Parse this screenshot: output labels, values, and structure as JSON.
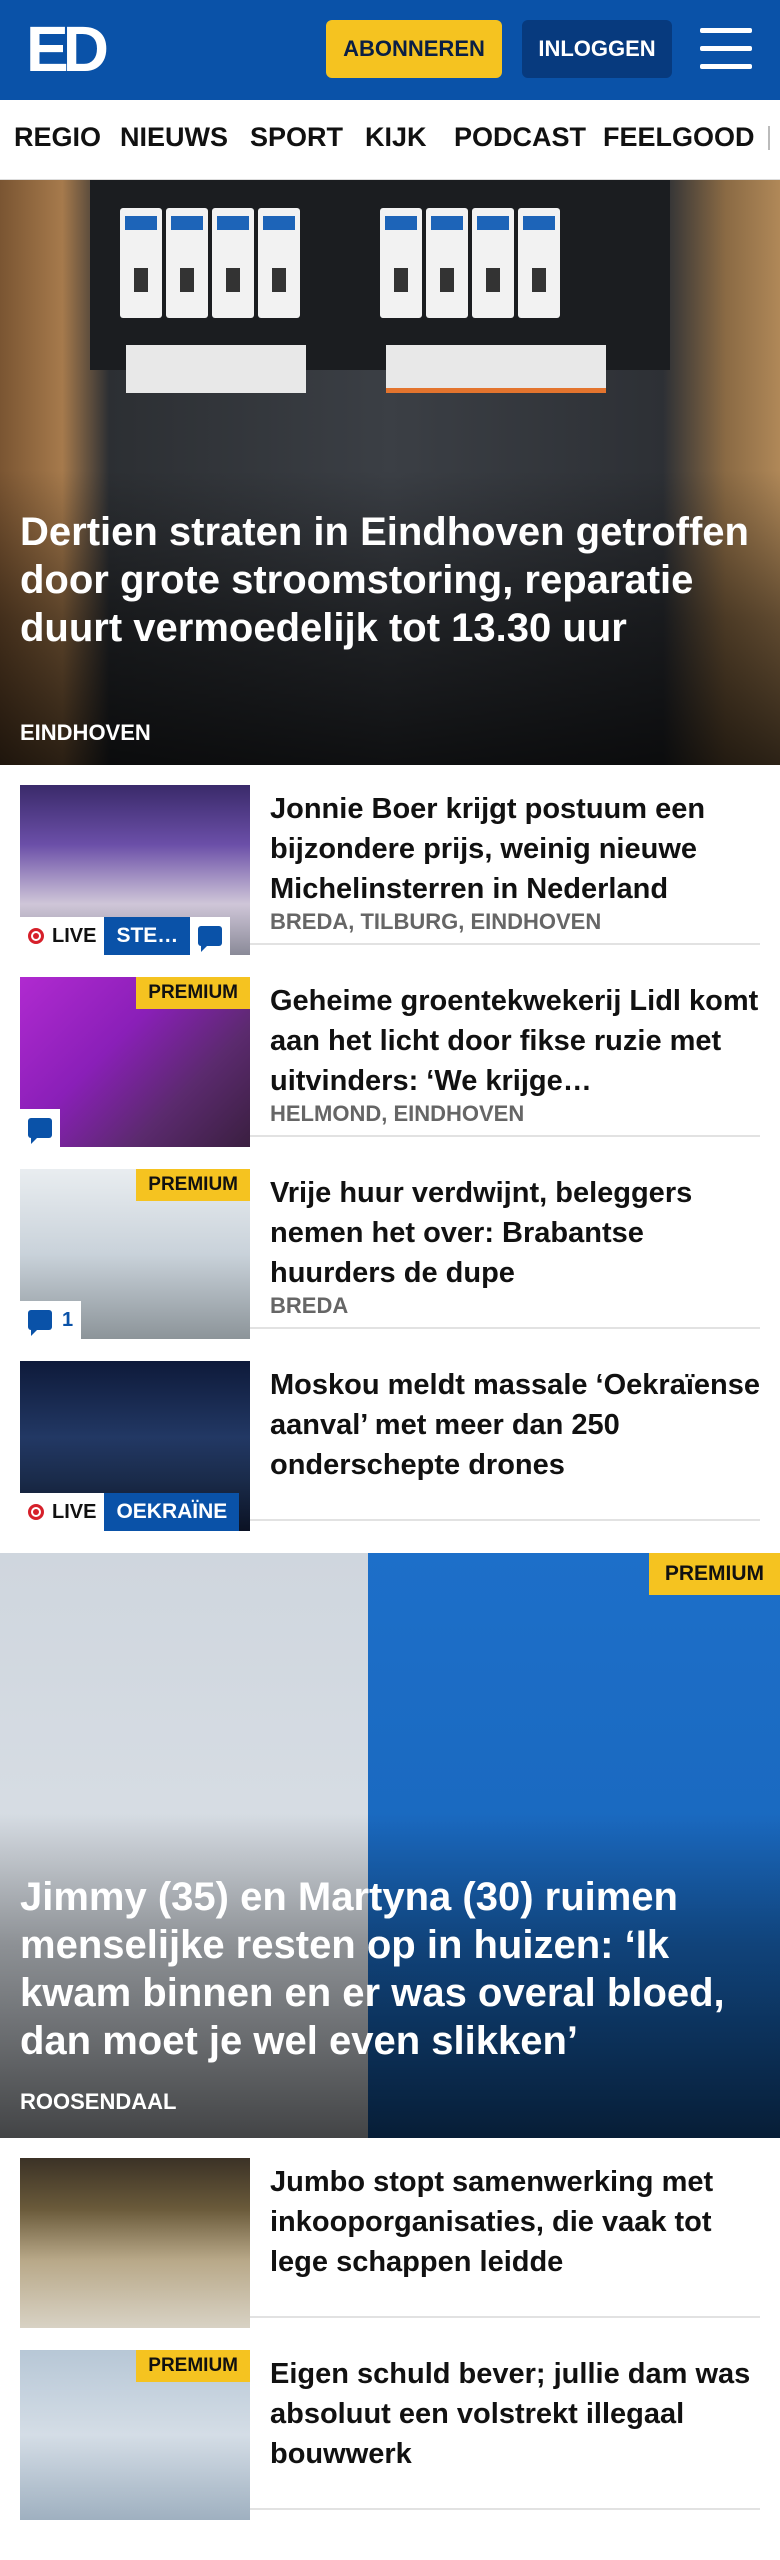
{
  "header": {
    "logo": "ED",
    "subscribe_label": "ABONNEREN",
    "login_label": "INLOGGEN",
    "menu_icon": "hamburger-icon"
  },
  "nav": {
    "items": [
      "REGIO",
      "NIEUWS",
      "SPORT",
      "KIJK",
      "PODCAST",
      "FEELGOOD"
    ]
  },
  "hero": {
    "title": "Dertien straten in Eindhoven getroffen door grote stroomstoring, reparatie duurt vermoedelijk tot 13.30 uur",
    "region": "EINDHOVEN"
  },
  "articles": [
    {
      "title": "Jonnie Boer krijgt postuum een bijzondere prijs, weinig nieuwe Michelinsterren in Nederland",
      "region": "BREDA, TILBURG, EINDHOVEN",
      "live_label": "LIVE",
      "live_topic": "STE…",
      "comment_icon": "comment-icon"
    },
    {
      "title": "Geheime groentekwekerij Lidl komt aan het licht door fikse ruzie met uitvinders: ‘We krijge…",
      "region": "HELMOND, EINDHOVEN",
      "premium_label": "PREMIUM",
      "comment_icon": "comment-icon"
    },
    {
      "title": "Vrije huur verdwijnt, beleggers nemen het over: Brabantse huurders de dupe",
      "region": "BREDA",
      "premium_label": "PREMIUM",
      "comment_count": "1",
      "comment_icon": "comment-icon"
    },
    {
      "title": "Moskou meldt massale ‘Oekraïense aanval’ met meer dan 250 onderschepte drones",
      "region": "",
      "live_label": "LIVE",
      "live_topic": "OEKRAÏNE"
    }
  ],
  "feature": {
    "premium_label": "PREMIUM",
    "title": "Jimmy (35) en Martyna (30) ruimen menselijke resten op in huizen: ‘Ik kwam binnen en er was overal bloed, dan moet je wel even slikken’",
    "region": "ROOSENDAAL"
  },
  "articles_bottom": [
    {
      "title": "Jumbo stopt samenwerking met inkooporganisaties, die vaak tot lege schappen leidde"
    },
    {
      "title": "Eigen schuld bever; jullie dam was absoluut een volstrekt illegaal bouwwerk",
      "premium_label": "PREMIUM"
    }
  ],
  "colors": {
    "brand_blue": "#0a52a8",
    "premium_yellow": "#f5c320",
    "live_red": "#d6202a"
  }
}
